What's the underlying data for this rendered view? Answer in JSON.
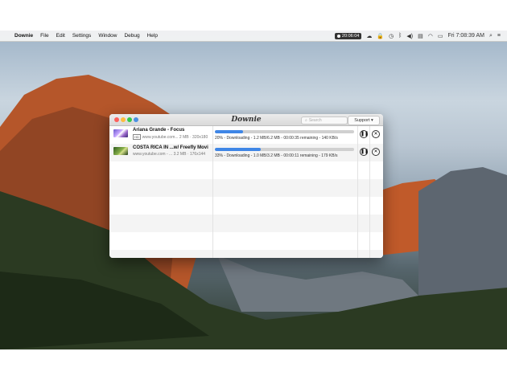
{
  "menubar": {
    "app_name": "Downie",
    "items": [
      "File",
      "Edit",
      "Settings",
      "Window",
      "Debug",
      "Help"
    ],
    "recording_time": "20:06:04",
    "clock": "Fri 7:08:39 AM"
  },
  "window": {
    "title": "Downie",
    "search_placeholder": "Search",
    "support_label": "Support ▾"
  },
  "downloads": [
    {
      "title": "Ariana Grande - Focus",
      "source": "www.youtube.com...",
      "details": "2 MB · 320x180",
      "progress": 20,
      "status": "20% - Downloading - 1.2 MB/6.2 MB - 00:00:35 remaining - 140 KB/s",
      "hd": false
    },
    {
      "title": "COSTA RICA IN ...w/ Freefly Movi",
      "source": "www.youtube.com - ...",
      "details": "3.2 MB · 176x144",
      "progress": 33,
      "status": "33% - Downloading - 1.0 MB/3.2 MB - 00:00:11 remaining - 179 KB/s",
      "hd": true
    }
  ],
  "icons": {
    "pause": "pause-icon",
    "cancel": "cancel-icon"
  },
  "colors": {
    "progress": "#3f86e6",
    "close": "#fc605c",
    "minimize": "#fdbc40",
    "zoom": "#34c84a"
  }
}
